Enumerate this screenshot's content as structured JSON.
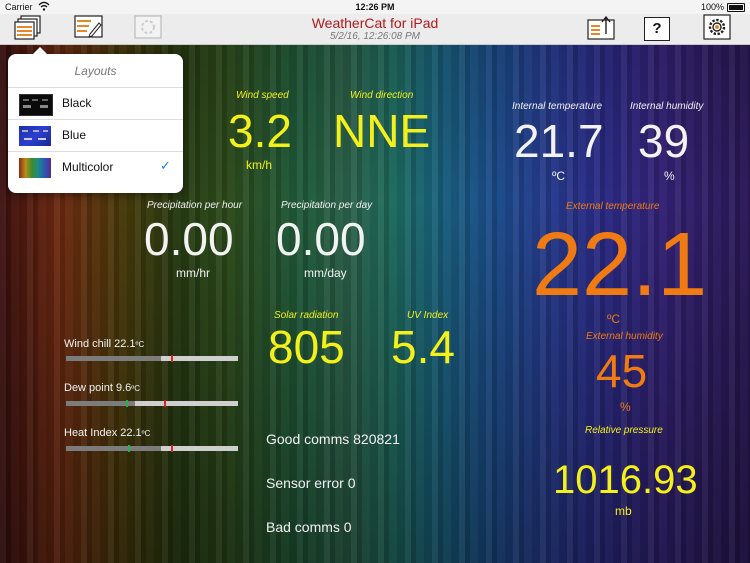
{
  "status_bar": {
    "carrier": "Carrier",
    "time": "12:26 PM",
    "battery": "100%"
  },
  "toolbar": {
    "title": "WeatherCat for iPad",
    "subtitle": "5/2/16, 12:26:08 PM",
    "left_icons": [
      "layouts-icon",
      "edit-icon",
      "refresh-icon"
    ],
    "right_icons": [
      "share-icon",
      "help-icon",
      "settings-icon"
    ],
    "help_glyph": "?"
  },
  "layouts_popover": {
    "header": "Layouts",
    "options": [
      {
        "name": "Black",
        "selected": false
      },
      {
        "name": "Blue",
        "selected": false
      },
      {
        "name": "Multicolor",
        "selected": true
      }
    ],
    "check_glyph": "✓"
  },
  "wind": {
    "speed_label": "Wind speed",
    "speed_value": "3.2",
    "speed_unit": "km/h",
    "direction_label": "Wind direction",
    "direction_value": "NNE"
  },
  "precipitation": {
    "hour_label": "Precipitation per hour",
    "hour_value": "0.00",
    "hour_unit": "mm/hr",
    "day_label": "Precipitation per day",
    "day_value": "0.00",
    "day_unit": "mm/day"
  },
  "solar": {
    "label": "Solar radiation",
    "value": "805"
  },
  "uv": {
    "label": "UV Index",
    "value": "5.4"
  },
  "indexes": [
    {
      "label": "Wind chill 22.1",
      "unit": "ºC",
      "level": 0.55
    },
    {
      "label": "Dew point  9.6",
      "unit": "ºC",
      "level": 0.4
    },
    {
      "label": "Heat Index 22.1",
      "unit": "ºC",
      "level": 0.55
    }
  ],
  "comms": {
    "good": "Good comms 820821",
    "sensor_error": "Sensor error 0",
    "bad": "Bad comms 0"
  },
  "internal": {
    "temp_label": "Internal temperature",
    "temp_value": "21.7",
    "temp_unit": "ºC",
    "hum_label": "Internal humidity",
    "hum_value": "39",
    "hum_unit": "%"
  },
  "external": {
    "temp_label": "External temperature",
    "temp_value": "22.1",
    "temp_unit": "ºC",
    "hum_label": "External humidity",
    "hum_value": "45",
    "hum_unit": "%"
  },
  "pressure": {
    "label": "Relative pressure",
    "value": "1016.93",
    "unit": "mb"
  },
  "colors": {
    "title": "#b3181c",
    "white_values": "#f2f2f2",
    "yellow_values": "#f3f01b",
    "orange_values": "#f07b12",
    "checkmark": "#1a7ee6"
  }
}
